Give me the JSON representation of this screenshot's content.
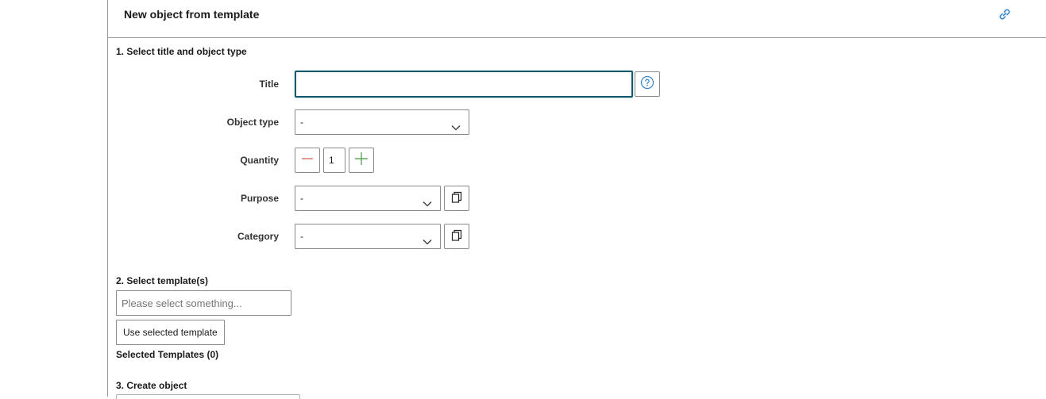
{
  "panel": {
    "title": "New object from template",
    "header_icon": "link-icon"
  },
  "section1": {
    "heading": "1. Select title and object type",
    "title_label": "Title",
    "title_value": "",
    "help_icon": "question-circle-icon",
    "object_type_label": "Object type",
    "object_type_value": "-",
    "quantity_label": "Quantity",
    "quantity_value": "1",
    "quantity_minus_icon": "minus-icon",
    "quantity_plus_icon": "plus-icon",
    "purpose_label": "Purpose",
    "purpose_value": "-",
    "category_label": "Category",
    "category_value": "-",
    "copy_icon": "copy-icon"
  },
  "section2": {
    "heading": "2. Select template(s)",
    "search_placeholder": "Please select something...",
    "use_button_label": "Use selected template",
    "selected_templates_label": "Selected Templates (0)"
  },
  "section3": {
    "heading": "3. Create object"
  },
  "colors": {
    "focus_border": "#135a6e",
    "icon_blue": "#3a86c8",
    "minus_red": "#d9534f",
    "plus_green": "#3c9a3c",
    "border_gray": "#8a8a8a"
  }
}
